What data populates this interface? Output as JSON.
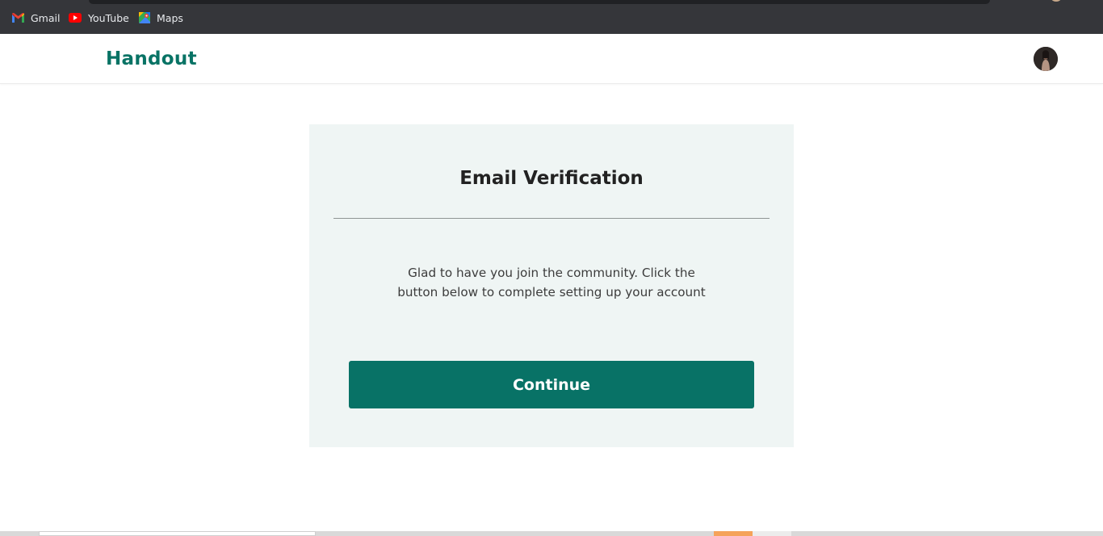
{
  "browser": {
    "bookmarks": [
      {
        "label": "Gmail",
        "icon": "gmail-icon"
      },
      {
        "label": "YouTube",
        "icon": "youtube-icon"
      },
      {
        "label": "Maps",
        "icon": "maps-icon"
      }
    ]
  },
  "header": {
    "logo_text": "Handout",
    "brand_color": "#087365"
  },
  "card": {
    "title": "Email Verification",
    "message": "Glad to have you join the community. Click the button below to complete setting up your account",
    "button_label": "Continue",
    "background_color": "#eff5f4",
    "button_color": "#087266"
  }
}
